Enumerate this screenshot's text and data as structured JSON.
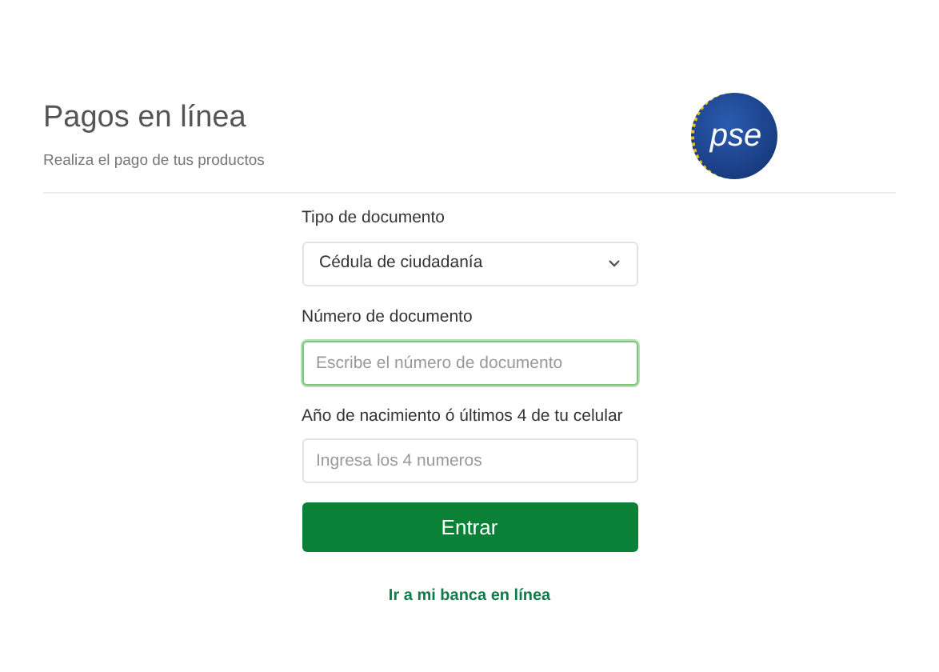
{
  "header": {
    "title": "Pagos en línea",
    "subtitle": "Realiza el pago de tus productos",
    "logo_text": "pse"
  },
  "form": {
    "fields": [
      {
        "kind": "select",
        "label": "Tipo de documento",
        "value": "Cédula de ciudadanía",
        "focused": false
      },
      {
        "kind": "input",
        "label": "Número de documento",
        "placeholder": "Escribe el número de documento",
        "focused": true
      },
      {
        "kind": "input",
        "label": "Año de nacimiento ó últimos 4 de tu celular",
        "placeholder": "Ingresa los 4 numeros",
        "focused": false
      }
    ],
    "submit": "Entrar",
    "link": "Ir a mi banca en línea"
  }
}
